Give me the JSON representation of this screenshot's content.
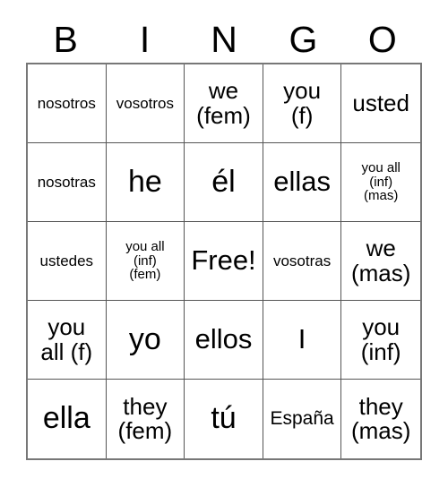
{
  "card": {
    "title": "BINGO",
    "header_letters": [
      "B",
      "I",
      "N",
      "G",
      "O"
    ],
    "free_space_label": "Free!",
    "colors": {
      "text": "#000000",
      "background": "#ffffff",
      "grid_line": "#555555",
      "outer_border": "#777777"
    },
    "grid_size": "5x5",
    "rows": [
      [
        {
          "text": "nosotros",
          "size": "s"
        },
        {
          "text": "vosotros",
          "size": "s"
        },
        {
          "text": "we\n(fem)",
          "size": "l"
        },
        {
          "text": "you\n(f)",
          "size": "l"
        },
        {
          "text": "usted",
          "size": "l"
        }
      ],
      [
        {
          "text": "nosotras",
          "size": "s"
        },
        {
          "text": "he",
          "size": "xxl"
        },
        {
          "text": "él",
          "size": "xxl"
        },
        {
          "text": "ellas",
          "size": "xl"
        },
        {
          "text": "you all\n(inf)\n(mas)",
          "size": "xs"
        }
      ],
      [
        {
          "text": "ustedes",
          "size": "s"
        },
        {
          "text": "you all\n(inf)\n(fem)",
          "size": "xs"
        },
        {
          "text": "Free!",
          "size": "xl"
        },
        {
          "text": "vosotras",
          "size": "s"
        },
        {
          "text": "we\n(mas)",
          "size": "l"
        }
      ],
      [
        {
          "text": "you\nall (f)",
          "size": "l"
        },
        {
          "text": "yo",
          "size": "xxl"
        },
        {
          "text": "ellos",
          "size": "xl"
        },
        {
          "text": "I",
          "size": "xl"
        },
        {
          "text": "you\n(inf)",
          "size": "l"
        }
      ],
      [
        {
          "text": "ella",
          "size": "xxl"
        },
        {
          "text": "they\n(fem)",
          "size": "l"
        },
        {
          "text": "tú",
          "size": "xxl"
        },
        {
          "text": "España",
          "size": "m"
        },
        {
          "text": "they\n(mas)",
          "size": "l"
        }
      ]
    ]
  }
}
